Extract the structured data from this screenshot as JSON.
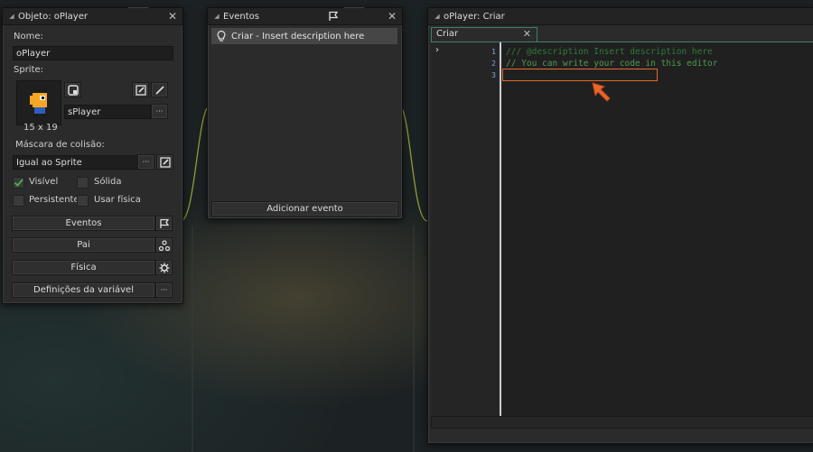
{
  "object_panel": {
    "title": "Objeto: oPlayer",
    "name_label": "Nome:",
    "name_value": "oPlayer",
    "sprite_label": "Sprite:",
    "sprite_name": "sPlayer",
    "sprite_size": "15 x 19",
    "mask_label": "Máscara de colisão:",
    "mask_value": "Igual ao Sprite",
    "ellipsis": "···",
    "checkboxes": {
      "visible": {
        "label": "Visível",
        "checked": true
      },
      "solid": {
        "label": "Sólida",
        "checked": false
      },
      "persistent": {
        "label": "Persistente",
        "checked": false
      },
      "physics": {
        "label": "Usar física",
        "checked": false
      }
    },
    "buttons": {
      "events": "Eventos",
      "parent": "Pai",
      "physics": "Física",
      "variables": "Definições da variável"
    }
  },
  "events_panel": {
    "title": "Eventos",
    "items": [
      {
        "label": "Criar - Insert description here"
      }
    ],
    "add_button": "Adicionar evento"
  },
  "code_editor": {
    "title": "oPlayer: Criar",
    "tab_label": "Criar",
    "lines": [
      {
        "n": "1",
        "text": "/// @description Insert description here"
      },
      {
        "n": "2",
        "text": "// You can write your code in this editor"
      },
      {
        "n": "3",
        "text": ""
      }
    ]
  },
  "colors": {
    "accent": "#3f7f6f",
    "check_green": "#4caf50",
    "comment_green": "#4f9a4f",
    "highlight_orange": "#e8672a",
    "link_curve": "#a4b23a"
  }
}
